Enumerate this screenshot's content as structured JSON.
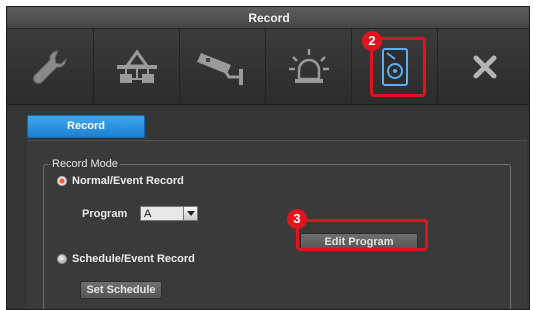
{
  "window": {
    "title": "Record"
  },
  "toolbar": {
    "items": [
      {
        "name": "system-settings",
        "icon": "wrench-icon"
      },
      {
        "name": "network",
        "icon": "network-icon"
      },
      {
        "name": "camera",
        "icon": "security-camera-icon"
      },
      {
        "name": "event-alarm",
        "icon": "alarm-siren-icon"
      },
      {
        "name": "record",
        "icon": "hdd-record-icon",
        "selected": true
      },
      {
        "name": "close",
        "icon": "close-icon"
      }
    ]
  },
  "markers": {
    "step2": "2",
    "step3": "3"
  },
  "tabs": {
    "active_label": "Record"
  },
  "record_mode": {
    "legend": "Record Mode",
    "normal_event_label": "Normal/Event Record",
    "program_label": "Program",
    "program_value": "A",
    "edit_program_label": "Edit Program",
    "schedule_event_label": "Schedule/Event Record",
    "set_schedule_label": "Set Schedule",
    "selected_mode": "Normal/Event Record"
  },
  "colors": {
    "accent_blue": "#2b8ee0",
    "highlight_red": "#e0141e"
  }
}
